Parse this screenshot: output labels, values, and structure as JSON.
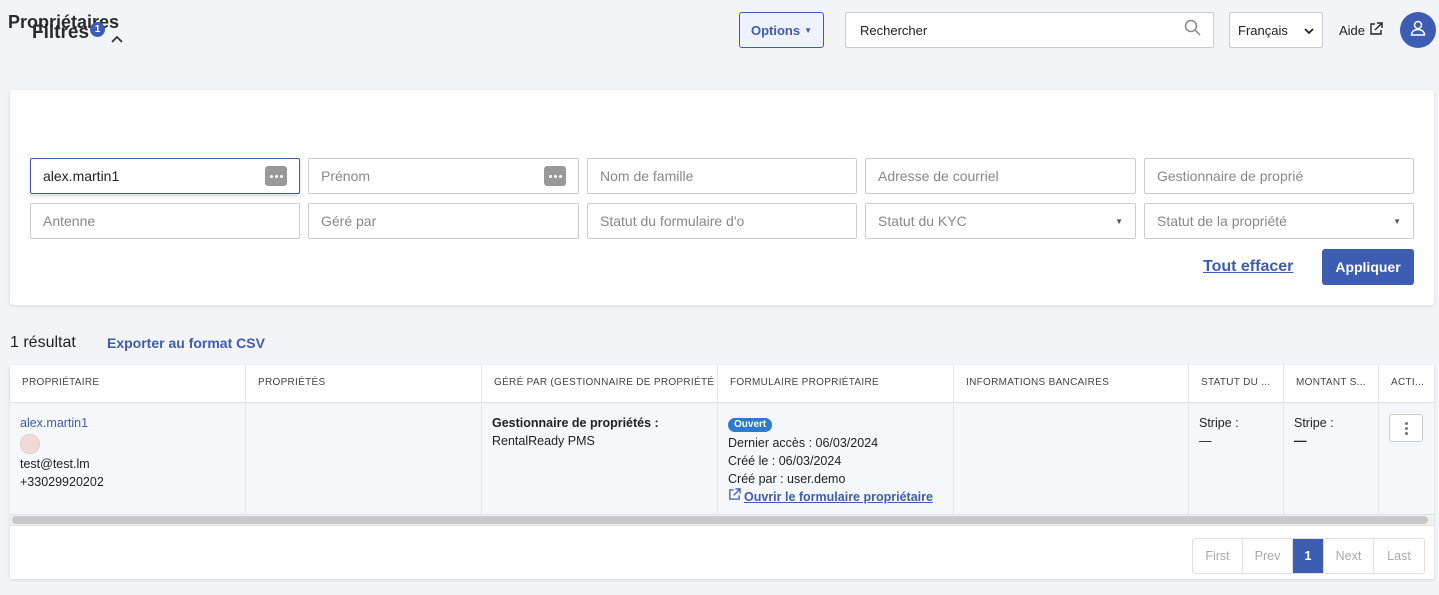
{
  "header": {
    "title": "Propriétaires",
    "options_label": "Options",
    "search_placeholder": "Rechercher",
    "language": "Français",
    "help_label": "Aide"
  },
  "filters": {
    "title": "Filtres",
    "active_count": "1",
    "owner_value": "alex.martin1",
    "first_name_placeholder": "Prénom",
    "last_name_placeholder": "Nom de famille",
    "email_placeholder": "Adresse de courriel",
    "manager_placeholder": "Gestionnaire de proprié",
    "branch_placeholder": "Antenne",
    "managed_by_placeholder": "Géré par",
    "form_status_placeholder": "Statut du formulaire d'o",
    "kyc_status_placeholder": "Statut du KYC",
    "property_status_placeholder": "Statut de la propriété",
    "clear_label": "Tout effacer",
    "apply_label": "Appliquer"
  },
  "results": {
    "count_label": "1 résultat",
    "export_label": "Exporter au format CSV"
  },
  "table": {
    "headers": [
      "PROPRIÉTAIRE",
      "PROPRIÉTÉS",
      "GÉRÉ PAR (GESTIONNAIRE DE PROPRIÉTÉ ...",
      "FORMULAIRE PROPRIÉTAIRE",
      "INFORMATIONS BANCAIRES",
      "STATUT DU ...",
      "MONTANT S...",
      "ACTI..."
    ],
    "row": {
      "owner_name": "alex.martin1",
      "owner_email": "test@test.lm",
      "owner_phone": "+33029920202",
      "manager_label": "Gestionnaire de propriétés :",
      "manager_value": "RentalReady PMS",
      "form_status": "Ouvert",
      "last_access": "Dernier accès : 06/03/2024",
      "created_on": "Créé le : 06/03/2024",
      "created_by": "Créé par : user.demo",
      "open_form_label": "Ouvrir le formulaire propriétaire",
      "status_stripe_label": "Stripe :",
      "status_stripe_value": "—",
      "amount_stripe_label": "Stripe :",
      "amount_stripe_value": "—"
    }
  },
  "pagination": {
    "first": "First",
    "prev": "Prev",
    "current": "1",
    "next": "Next",
    "last": "Last"
  },
  "colors": {
    "accent": "#3d5db3",
    "badge_blue": "#2b7bd1",
    "page_bg": "#f2f4f8"
  }
}
